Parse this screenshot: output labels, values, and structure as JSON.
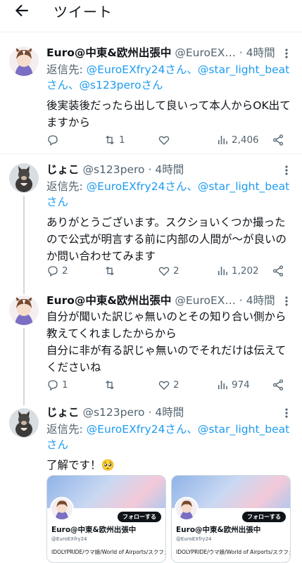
{
  "header": {
    "title": "ツイート"
  },
  "tweets": [
    {
      "name": "Euro@中東&欧州出張中",
      "handle": "@EuroEX…",
      "time": "4時間",
      "reply_prefix": "返信先: ",
      "reply_line1": "@EuroEXfry24さん、@star_light_beat",
      "reply_line2": "さん、@s123peroさん",
      "text": "後実装後だったら出して良いって本人からOK出てますから",
      "stats": {
        "replies": "",
        "retweets": "1",
        "likes": "",
        "views": "2,406"
      }
    },
    {
      "name": "じょこ",
      "handle": "@s123pero",
      "time": "4時間",
      "reply_prefix": "返信先: ",
      "reply_line1": "@EuroEXfry24さん、@star_light_beat",
      "reply_line2": "さん",
      "text": "ありがとうございます。スクショいくつか撮ったので公式が明言する前に内部の人間が〜が良いのか問い合わせてみます",
      "stats": {
        "replies": "2",
        "retweets": "",
        "likes": "2",
        "views": "1,202"
      }
    },
    {
      "name": "Euro@中東&欧州出張中",
      "handle": "@EuroEX…",
      "time": "4時間",
      "text": "自分が聞いた訳じゃ無いのとその知り合い側から教えてくれましたからから\n自分に非が有る訳じゃ無いのでそれだけは伝えてくださいね",
      "stats": {
        "replies": "1",
        "retweets": "",
        "likes": "2",
        "views": "974"
      }
    },
    {
      "name": "じょこ",
      "handle": "@s123pero",
      "time": "4時間",
      "reply_prefix": "返信先: ",
      "reply_line1": "@EuroEXfry24さん、@star_light_beat",
      "reply_line2": "さん",
      "text": "了解です！🥺"
    }
  ],
  "cards": [
    {
      "follow": "フォローする",
      "name": "Euro@中東&欧州出張中",
      "handle": "@EuroEXfry24",
      "bio": "IDOLYPRIDE/ウマ娘/World of Airports/スクフェ"
    },
    {
      "follow": "フォローする",
      "name": "Euro@中東&欧州出張中",
      "handle": "@EuroEXfry24",
      "bio": "IDOLYPRIDE/ウマ娘/World of Airports/スクフェス"
    }
  ]
}
